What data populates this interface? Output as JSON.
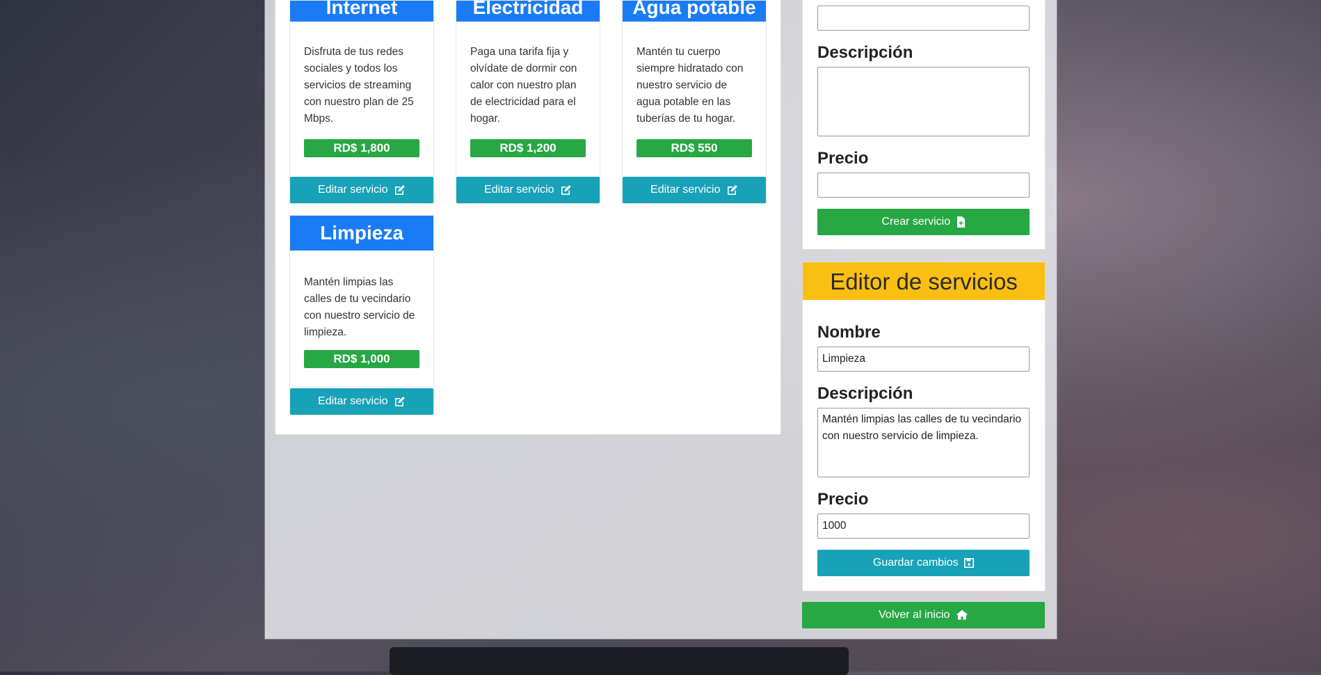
{
  "services": [
    {
      "title": "Internet",
      "description": "Disfruta de tus redes sociales y todos los servicios de streaming con nuestro plan de 25 Mbps.",
      "price": "RD$ 1,800",
      "edit_label": "Editar servicio"
    },
    {
      "title": "Electricidad",
      "description": "Paga una tarifa fija y olvídate de dormir con calor con nuestro plan de electricidad para el hogar.",
      "price": "RD$ 1,200",
      "edit_label": "Editar servicio"
    },
    {
      "title": "Agua potable",
      "description": "Mantén tu cuerpo siempre hidratado con nuestro servicio de agua potable en las tuberías de tu hogar.",
      "price": "RD$ 550",
      "edit_label": "Editar servicio"
    },
    {
      "title": "Limpieza",
      "description": "Mantén limpias las calles de tu vecindario con nuestro servicio de limpieza.",
      "price": "RD$ 1,000",
      "edit_label": "Editar servicio"
    }
  ],
  "create_form": {
    "name_value": "",
    "description_label": "Descripción",
    "description_value": "",
    "price_label": "Precio",
    "price_value": "",
    "submit_label": "Crear servicio"
  },
  "editor": {
    "title": "Editor de servicios",
    "name_label": "Nombre",
    "name_value": "Limpieza",
    "description_label": "Descripción",
    "description_value": "Mantén limpias las calles de tu vecindario con nuestro servicio de limpieza.",
    "price_label": "Precio",
    "price_value": "1000",
    "submit_label": "Guardar cambios"
  },
  "home_button_label": "Volver al inicio",
  "colors": {
    "card_header": "#1a7cf5",
    "price_badge": "#28a745",
    "edit_button": "#17a2b8",
    "editor_header": "#fbbf14",
    "home_button": "#28a745"
  }
}
